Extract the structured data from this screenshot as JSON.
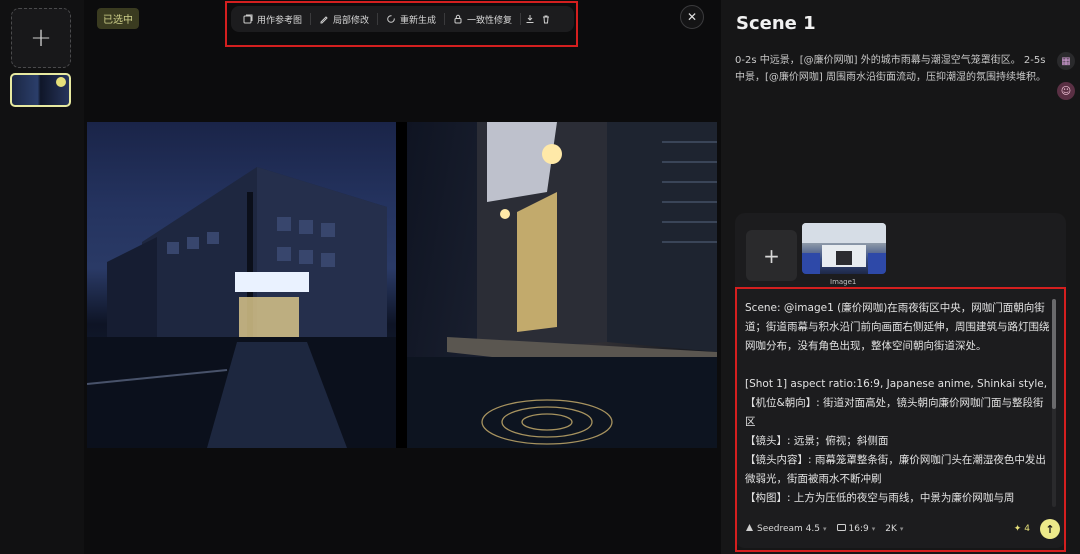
{
  "rail": {
    "add_label": "+"
  },
  "canvas": {
    "selected_badge": "已选中",
    "toolbar": {
      "use_as_reference": "用作参考图",
      "local_edit": "局部修改",
      "regenerate": "重新生成",
      "consistency_fix": "一致性修复",
      "download_icon": "download-icon",
      "delete_icon": "trash-icon"
    },
    "close_label": "✕"
  },
  "panel": {
    "scene_title": "Scene 1",
    "scene_desc": "0-2s 中远景，[@廉价网咖] 外的城市雨幕与潮湿空气笼罩街区。 2-5s 中景，[@廉价网咖] 周围雨水沿街面流动，压抑潮湿的氛围持续堆积。",
    "ref_add_label": "+",
    "ref_caption": "Image1",
    "prompt": "Scene: @image1 (廉价网咖)在雨夜街区中央，网咖门面朝向街道；街道雨幕与积水沿门前向画面右侧延伸，周围建筑与路灯围绕网咖分布，没有角色出现，整体空间朝向街道深处。\n\n[Shot 1] aspect ratio:16:9, Japanese anime, Shinkai style,\n【机位&朝向】: 街道对面高处，镜头朝向廉价网咖门面与整段街区\n【镜头】: 远景；俯视；斜侧面\n【镜头内容】: 雨幕笼罩整条街，廉价网咖门头在潮湿夜色中发出微弱光，街面被雨水不断冲刷\n【构图】: 上方为压低的夜空与雨线，中景为廉价网咖与周",
    "model": "Seedream 4.5",
    "aspect": "16:9",
    "resolution": "2K",
    "credits": "4",
    "send_label": "↑"
  },
  "colors": {
    "accent_yellow": "#ece98a",
    "highlight_red": "#d41f1f"
  }
}
